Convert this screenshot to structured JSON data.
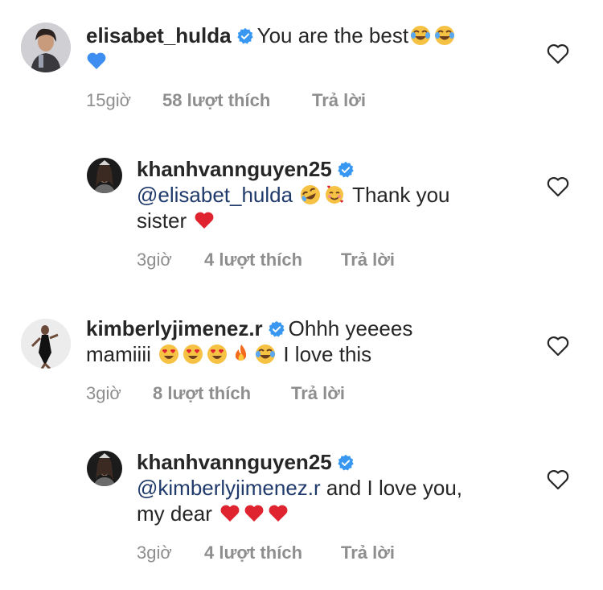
{
  "comments": [
    {
      "username": "elisabet_hulda",
      "text_before": "You are the best",
      "emojis_inline": [
        "face-with-tears-of-joy-emoji",
        "face-with-tears-of-joy-emoji"
      ],
      "trailing_emoji": "blue-heart-emoji",
      "time": "15giờ",
      "likes": "58 lượt thích",
      "reply": "Trả lời"
    },
    {
      "username": "khanhvannguyen25",
      "mention": "@elisabet_hulda",
      "text_after": "Thank you",
      "text_line2": "sister",
      "time": "3giờ",
      "likes": "4 lượt thích",
      "reply": "Trả lời"
    },
    {
      "username": "kimberlyjimenez.r",
      "text_before": "Ohhh yeeees",
      "text_line2_start": "mamiiii",
      "text_end": "I love this",
      "time": "3giờ",
      "likes": "8 lượt thích",
      "reply": "Trả lời"
    },
    {
      "username": "khanhvannguyen25",
      "mention": "@kimberlyjimenez.r",
      "text_after": "and I love you,",
      "text_line2": "my dear",
      "time": "3giờ",
      "likes": "4 lượt thích",
      "reply": "Trả lời"
    }
  ],
  "colors": {
    "text": "#262626",
    "meta": "#8e8e8e",
    "mention": "#1f3a6b",
    "verified": "#3897f0",
    "heart": "#e0242f",
    "blue_heart": "#3d8ef0",
    "emoji_face": "#f6c244"
  }
}
